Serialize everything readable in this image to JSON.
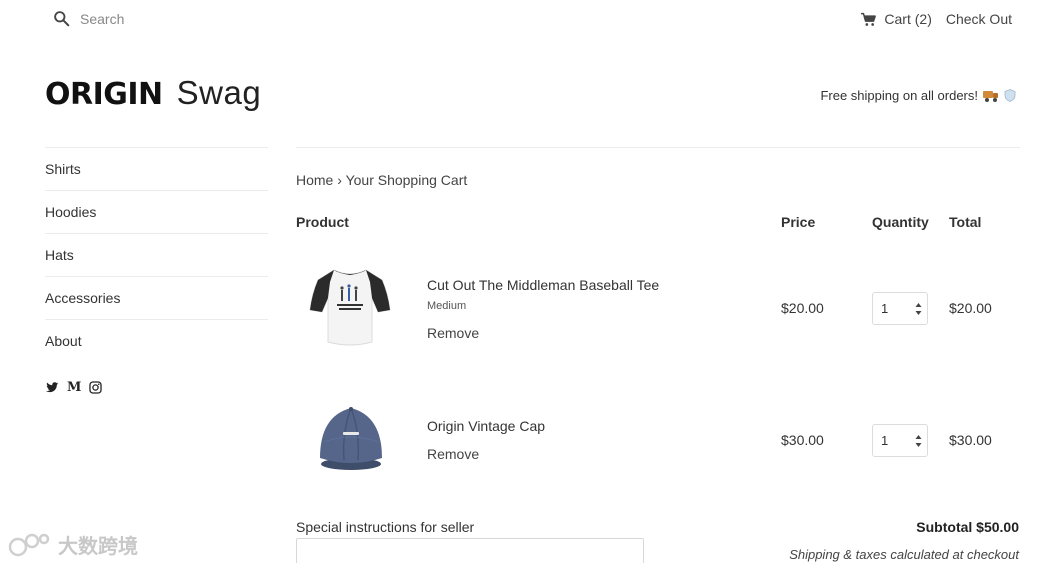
{
  "topbar": {
    "search_placeholder": "Search",
    "cart_label": "Cart (2)",
    "checkout_label": "Check Out"
  },
  "brand": {
    "logo_word": "ORIGIN",
    "logo_suffix": "Swag"
  },
  "header": {
    "shipping_banner": "Free shipping on all orders!"
  },
  "sidebar": {
    "items": [
      {
        "label": "Shirts"
      },
      {
        "label": "Hoodies"
      },
      {
        "label": "Hats"
      },
      {
        "label": "Accessories"
      },
      {
        "label": "About"
      }
    ],
    "socials": [
      "twitter-icon",
      "medium-icon",
      "instagram-icon"
    ]
  },
  "breadcrumb": {
    "home": "Home",
    "separator": "›",
    "current": "Your Shopping Cart"
  },
  "cart_table": {
    "headers": {
      "product": "Product",
      "price": "Price",
      "quantity": "Quantity",
      "total": "Total"
    },
    "items": [
      {
        "title": "Cut Out The Middleman Baseball Tee",
        "variant": "Medium",
        "remove_label": "Remove",
        "price": "$20.00",
        "quantity": "1",
        "total": "$20.00",
        "image_text": "CUT OUT THE MIDDLEMAN"
      },
      {
        "title": "Origin Vintage Cap",
        "variant": "",
        "remove_label": "Remove",
        "price": "$30.00",
        "quantity": "1",
        "total": "$30.00",
        "image_text": "ORIGIN"
      }
    ]
  },
  "footer": {
    "instructions_label": "Special instructions for seller",
    "subtotal": "Subtotal $50.00",
    "taxes_note": "Shipping & taxes calculated at checkout"
  },
  "watermark": {
    "text": "大数跨境"
  },
  "colors": {
    "text": "#333333",
    "muted": "#888888",
    "divider": "#ececec",
    "cap": "#4a5a7a",
    "shirt_sleeves": "#2b2b2b"
  }
}
